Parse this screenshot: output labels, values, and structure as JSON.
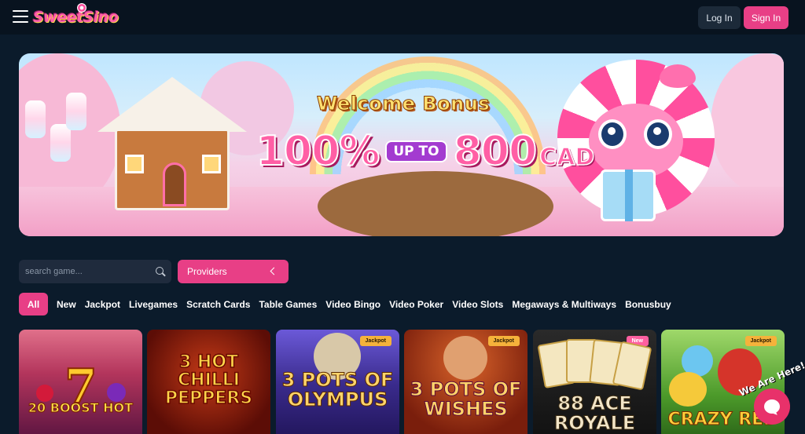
{
  "header": {
    "logo_text": "SweetSino",
    "login_label": "Log In",
    "signin_label": "Sign In"
  },
  "banner": {
    "headline": "Welcome Bonus",
    "percent": "100%",
    "up_to": "UP TO",
    "amount": "800",
    "currency": "CAD"
  },
  "search": {
    "placeholder": "search game..."
  },
  "providers": {
    "label": "Providers"
  },
  "categories": [
    "All",
    "New",
    "Jackpot",
    "Livegames",
    "Scratch Cards",
    "Table Games",
    "Video Bingo",
    "Video Poker",
    "Video Slots",
    "Megaways & Multiways",
    "Bonusbuy"
  ],
  "games": [
    {
      "title": "20 BOOST HOT",
      "badge": ""
    },
    {
      "title": "3 HOT CHILLI PEPPERS",
      "badge": ""
    },
    {
      "title": "3 POTS OF OLYMPUS",
      "badge": "Jackpot"
    },
    {
      "title": "3 POTS OF WISHES",
      "badge": "Jackpot"
    },
    {
      "title": "88 ACE ROYALE",
      "badge": "New"
    },
    {
      "title": "CRAZY RED",
      "badge": "Jackpot"
    }
  ],
  "chat": {
    "label": "We Are Here!"
  },
  "colors": {
    "accent": "#e83f86",
    "background": "#0b1b2b",
    "header": "#08131f",
    "jackpot_badge": "#f5b23b",
    "new_badge": "#ff5fa0"
  },
  "icons": [
    "menu-icon",
    "search-icon",
    "chevron-left-icon",
    "chat-icon"
  ]
}
